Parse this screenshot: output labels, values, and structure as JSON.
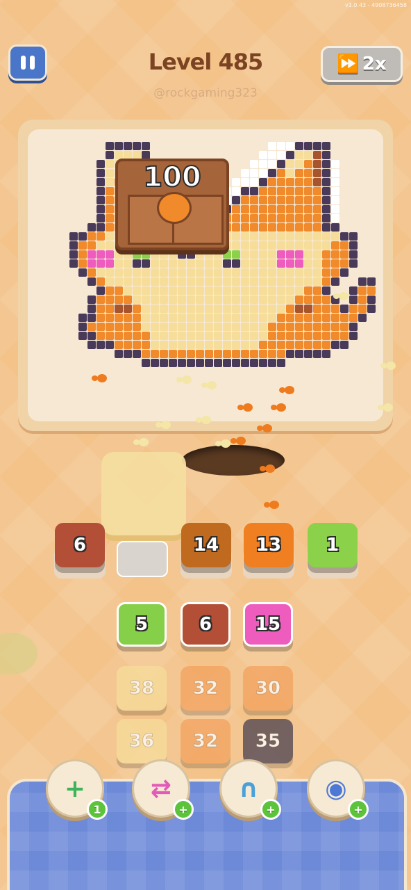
{
  "header": {
    "version": "v1.0.43 - 4908736458",
    "title": "Level 485",
    "username": "@rockgaming323",
    "speed_label": "2x"
  },
  "board": {
    "chest_count": "100"
  },
  "queue_slots": [
    {
      "value": "6",
      "color": "#b34f37",
      "empty": false
    },
    {
      "value": "",
      "color": "",
      "empty": true
    },
    {
      "value": "14",
      "color": "#bf6a1e",
      "empty": false
    },
    {
      "value": "13",
      "color": "#f07f22",
      "empty": false
    },
    {
      "value": "1",
      "color": "#8bd24a",
      "empty": false
    }
  ],
  "grid": [
    [
      {
        "value": "5",
        "color": "#86cf48",
        "faded": false
      },
      {
        "value": "6",
        "color": "#b34f37",
        "faded": false
      },
      {
        "value": "15",
        "color": "#ee5cbd",
        "faded": false
      }
    ],
    [
      {
        "value": "38",
        "color": "#f6dd9a",
        "faded": true
      },
      {
        "value": "32",
        "color": "#f3a25e",
        "faded": true
      },
      {
        "value": "30",
        "color": "#f3a25e",
        "faded": true
      }
    ],
    [
      {
        "value": "36",
        "color": "#f6dd9a",
        "faded": true
      },
      {
        "value": "32",
        "color": "#f3a25e",
        "faded": true
      },
      {
        "value": "35",
        "color": "#4a4150",
        "faded": true
      }
    ]
  ],
  "boosters": [
    {
      "name": "add-slot",
      "symbol": "+",
      "badge": "1",
      "color": "#3fb35b"
    },
    {
      "name": "shuffle",
      "symbol": "⇄",
      "badge": "+",
      "color": "#e25bb8"
    },
    {
      "name": "magnet",
      "symbol": "∩",
      "badge": "+",
      "color": "#4aa0d8"
    },
    {
      "name": "donut",
      "symbol": "◉",
      "badge": "+",
      "color": "#4d78d6"
    }
  ]
}
